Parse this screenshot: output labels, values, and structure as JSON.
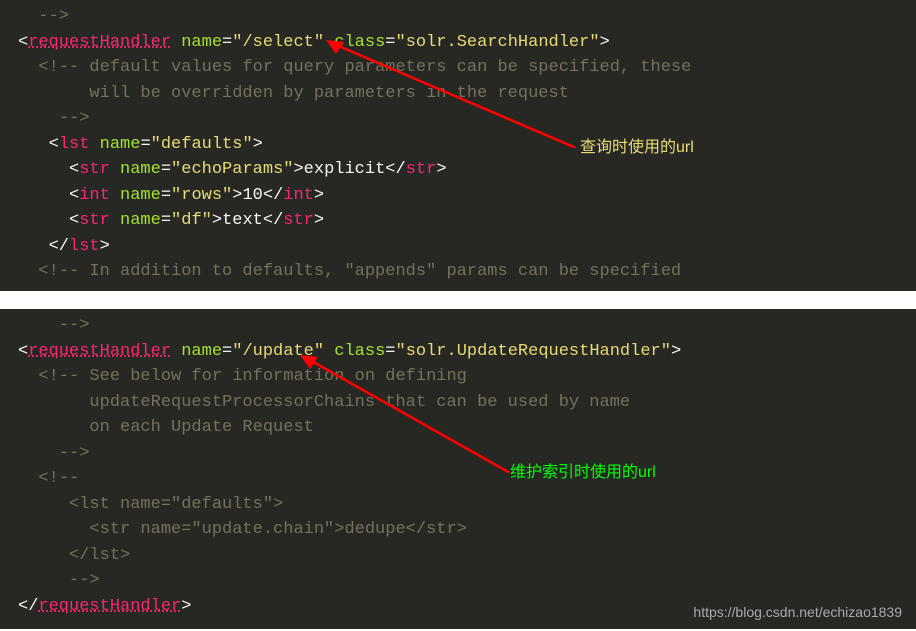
{
  "panel1": {
    "line0": "  -->",
    "line1_p1": "<",
    "line1_p2": "requestHandler",
    "line1_p3": " name",
    "line1_p4": "=",
    "line1_p5": "\"/select\"",
    "line1_p6": " class",
    "line1_p7": "=",
    "line1_p8": "\"solr.SearchHandler\"",
    "line1_p9": ">",
    "line2": "  <!-- default values for query parameters can be specified, these",
    "line3": "       will be overridden by parameters in the request",
    "line4": "    -->",
    "line5_p1": "   <",
    "line5_p2": "lst",
    "line5_p3": " name",
    "line5_p4": "=",
    "line5_p5": "\"defaults\"",
    "line5_p6": ">",
    "line6_p1": "     <",
    "line6_p2": "str",
    "line6_p3": " name",
    "line6_p4": "=",
    "line6_p5": "\"echoParams\"",
    "line6_p6": ">",
    "line6_p7": "explicit",
    "line6_p8": "</",
    "line6_p9": "str",
    "line6_p10": ">",
    "line7_p1": "     <",
    "line7_p2": "int",
    "line7_p3": " name",
    "line7_p4": "=",
    "line7_p5": "\"rows\"",
    "line7_p6": ">",
    "line7_p7": "10",
    "line7_p8": "</",
    "line7_p9": "int",
    "line7_p10": ">",
    "line8_p1": "     <",
    "line8_p2": "str",
    "line8_p3": " name",
    "line8_p4": "=",
    "line8_p5": "\"df\"",
    "line8_p6": ">",
    "line8_p7": "text",
    "line8_p8": "</",
    "line8_p9": "str",
    "line8_p10": ">",
    "line9_p1": "   </",
    "line9_p2": "lst",
    "line9_p3": ">",
    "line10": "  <!-- In addition to defaults, \"appends\" params can be specified"
  },
  "panel2": {
    "line0": "    -->",
    "line1_p1": "<",
    "line1_p2": "requestHandler",
    "line1_p3": " name",
    "line1_p4": "=",
    "line1_p5": "\"/update\"",
    "line1_p6": " class",
    "line1_p7": "=",
    "line1_p8": "\"solr.UpdateRequestHandler\"",
    "line1_p9": ">",
    "line2": "  <!-- See below for information on defining",
    "line3": "       updateRequestProcessorChains that can be used by name",
    "line4": "       on each Update Request",
    "line5": "    -->",
    "line6": "  <!--",
    "line7": "     <lst name=\"defaults\">",
    "line8": "       <str name=\"update.chain\">dedupe</str>",
    "line9": "     </lst>",
    "line10": "     -->",
    "line11_p1": "</",
    "line11_p2": "requestHandler",
    "line11_p3": ">"
  },
  "annotation1": "查询时使用的url",
  "annotation2": "维护索引时使用的url",
  "watermark": "https://blog.csdn.net/echizao1839"
}
